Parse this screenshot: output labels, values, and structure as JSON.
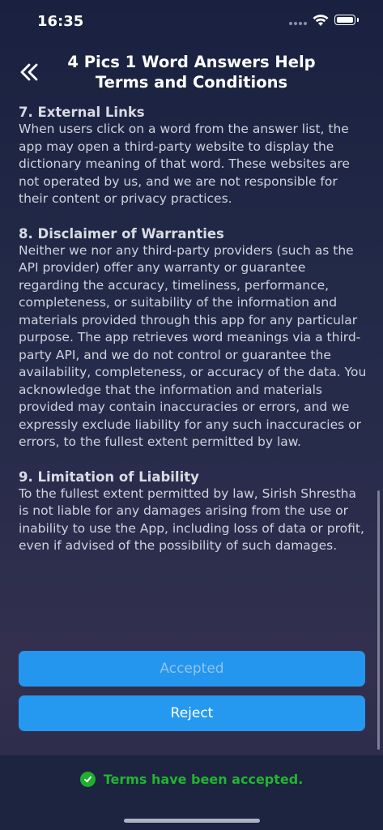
{
  "status_bar": {
    "time": "16:35"
  },
  "header": {
    "title_line1": "4 Pics 1 Word Answers Help",
    "title_line2": "Terms and Conditions"
  },
  "sections": [
    {
      "heading": "7. External Links",
      "body": "When users click on a word from the answer list, the app may open a third-party website to display the dictionary meaning of that word. These websites are not operated by us, and we are not responsible for their content or privacy practices."
    },
    {
      "heading": "8. Disclaimer of Warranties",
      "body": "Neither we nor any third-party providers (such as the API provider) offer any warranty or guarantee regarding the accuracy, timeliness, performance, completeness, or suitability of the information and materials provided through this app for any particular purpose. The app retrieves word meanings via a third-party API, and we do not control or guarantee the availability, completeness, or accuracy of the data. You acknowledge that the information and materials provided may contain inaccuracies or errors, and we expressly exclude liability for any such inaccuracies or errors, to the fullest extent permitted by law."
    },
    {
      "heading": "9. Limitation of Liability",
      "body": "To the fullest extent permitted by law, Sirish Shrestha is not liable for any damages arising from the use or inability to use the App, including loss of data or profit, even if advised of the possibility of such damages."
    }
  ],
  "buttons": {
    "accepted_label": "Accepted",
    "reject_label": "Reject"
  },
  "footer": {
    "notice": "Terms have been accepted."
  },
  "colors": {
    "accent": "#2598f0",
    "success": "#22b530"
  }
}
